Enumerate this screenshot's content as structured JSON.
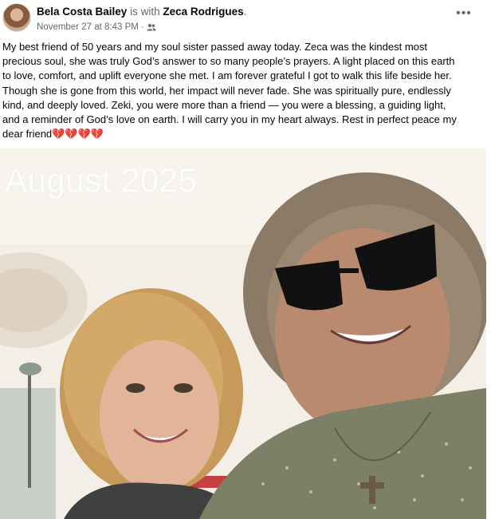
{
  "post": {
    "author": "Bela Costa Bailey",
    "with_text": "is with",
    "tagged": "Zeca Rodrigues",
    "period": ".",
    "timestamp": "November 27 at 8:43 PM",
    "separator": "·",
    "audience_icon": "friends-icon",
    "more_icon": "more-options-icon",
    "more_label": "•••",
    "text_lines": [
      "My best friend of 50 years and my soul sister passed away today.  Zeca was the kindest most",
      "precious soul, she was truly God’s answer to so many people’s prayers. A light placed on this earth",
      "to love, comfort, and uplift everyone she met. I am forever grateful I got to walk this life beside her.",
      "Though she is gone from this world, her impact will never fade. She was spiritually pure, endlessly",
      "kind, and deeply loved. Zeki, you were more than a friend — you were a blessing, a guiding light,",
      "and a reminder of God’s love on earth. I will carry you in my heart always.  Rest in perfect peace my"
    ],
    "last_line": "dear friend",
    "hearts": "💔💔💔💔"
  },
  "photo": {
    "caption": "August 2025"
  },
  "colors": {
    "text": "#050505",
    "secondary": "#65676b",
    "heart": "#d8213a"
  }
}
